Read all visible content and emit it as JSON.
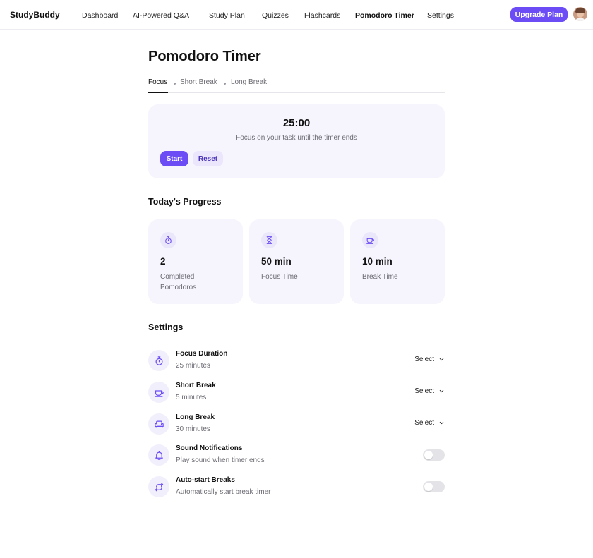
{
  "app": {
    "brand": "StudyBuddy",
    "accent_color": "#6c4df5"
  },
  "nav": {
    "items": [
      {
        "label": "Dashboard",
        "active": false
      },
      {
        "label": "AI-Powered Q&A",
        "active": false
      },
      {
        "label": "Study Plan",
        "active": false
      },
      {
        "label": "Quizzes",
        "active": false
      },
      {
        "label": "Flashcards",
        "active": false
      },
      {
        "label": "Pomodoro Timer",
        "active": true
      },
      {
        "label": "Settings",
        "active": false
      }
    ],
    "upgrade_label": "Upgrade Plan",
    "avatar_icon": "user-avatar"
  },
  "page": {
    "title": "Pomodoro Timer",
    "tabs": [
      {
        "label": "Focus",
        "active": true
      },
      {
        "label": "Short Break",
        "active": false
      },
      {
        "label": "Long Break",
        "active": false
      }
    ]
  },
  "timer": {
    "time": "25:00",
    "subtitle": "Focus on your task until the timer ends",
    "start_label": "Start",
    "reset_label": "Reset"
  },
  "progress": {
    "title": "Today's Progress",
    "stats": [
      {
        "icon": "stopwatch-icon",
        "value": "2",
        "label": "Completed Pomodoros"
      },
      {
        "icon": "hourglass-icon",
        "value": "50 min",
        "label": "Focus Time"
      },
      {
        "icon": "coffee-cup-icon",
        "value": "10 min",
        "label": "Break Time"
      }
    ]
  },
  "settings": {
    "title": "Settings",
    "rows": [
      {
        "icon": "timer-icon",
        "title": "Focus Duration",
        "subtitle": "25 minutes",
        "control": "select",
        "control_label": "Select"
      },
      {
        "icon": "coffee-cup-icon",
        "title": "Short Break",
        "subtitle": "5 minutes",
        "control": "select",
        "control_label": "Select"
      },
      {
        "icon": "couch-icon",
        "title": "Long Break",
        "subtitle": "30 minutes",
        "control": "select",
        "control_label": "Select"
      },
      {
        "icon": "bell-icon",
        "title": "Sound Notifications",
        "subtitle": "Play sound when timer ends",
        "control": "toggle",
        "enabled": false
      },
      {
        "icon": "refresh-icon",
        "title": "Auto-start Breaks",
        "subtitle": "Automatically start break timer",
        "control": "toggle",
        "enabled": false
      }
    ]
  }
}
